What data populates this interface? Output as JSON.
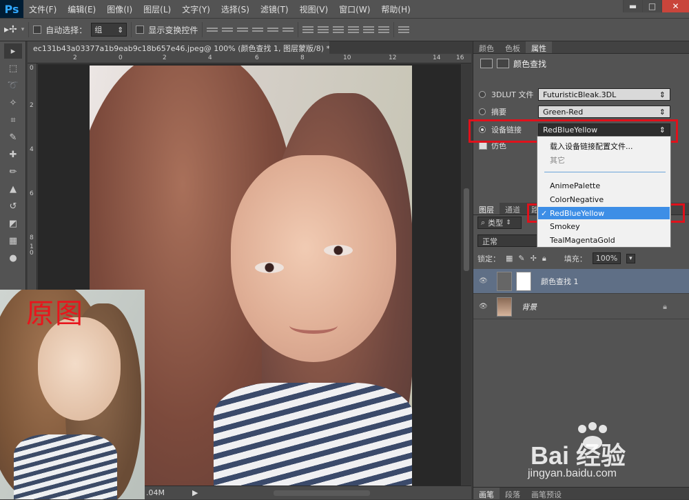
{
  "app": {
    "logo": "Ps"
  },
  "menu": [
    "文件(F)",
    "编辑(E)",
    "图像(I)",
    "图层(L)",
    "文字(Y)",
    "选择(S)",
    "滤镜(T)",
    "视图(V)",
    "窗口(W)",
    "帮助(H)"
  ],
  "window_controls": {
    "minimize": "▬",
    "restore": "□",
    "close": "✕"
  },
  "options": {
    "auto_select_label": "自动选择：",
    "auto_select_value": "组",
    "show_transform_label": "显示变换控件"
  },
  "document": {
    "tab_title": "ec131b43a03377a1b9eab9c18b657e46.jpeg@ 100% (颜色查找 1, 图层蒙版/8) *",
    "tab_close": "×",
    "ruler_top": [
      "2",
      "0",
      "2",
      "4",
      "6",
      "8",
      "10",
      "12",
      "14",
      "16"
    ],
    "ruler_left": [
      "0",
      "2",
      "4",
      "6",
      "8",
      "1 0"
    ],
    "status_size": ".04M",
    "status_arrow": "▶"
  },
  "overlay": {
    "original_label": "原图"
  },
  "properties": {
    "tabs": [
      "颜色",
      "色板",
      "属性"
    ],
    "title": "颜色查找",
    "rows": [
      {
        "label": "3DLUT 文件",
        "value": "FuturisticBleak.3DL"
      },
      {
        "label": "摘要",
        "value": "Green-Red"
      },
      {
        "label": "设备链接",
        "value": "RedBlueYellow"
      }
    ],
    "dither_label": "仿色",
    "dropdown": {
      "load_item": "载入设备链接配置文件...",
      "other_item": "其它",
      "items": [
        "AnimePalette",
        "ColorNegative",
        "RedBlueYellow",
        "Smokey",
        "TealMagentaGold"
      ],
      "check": "✓"
    }
  },
  "layers": {
    "tabs": [
      "图层",
      "通道",
      "路径"
    ],
    "filter_label": "类型",
    "blend_mode": "正常",
    "lock_label": "锁定：",
    "fill_label": "填充：",
    "fill_value": "100%",
    "items": [
      {
        "name": "颜色查找 1"
      },
      {
        "name": "背景"
      }
    ]
  },
  "bottom_tabs": [
    "画笔",
    "段落",
    "画笔预设"
  ],
  "watermark": {
    "brand": "Bai 经验",
    "url": "jingyan.baidu.com"
  },
  "colors": {
    "accent_red": "#e0111b",
    "selection_blue": "#3d8ee6",
    "ps_blue": "#31a8ff"
  }
}
